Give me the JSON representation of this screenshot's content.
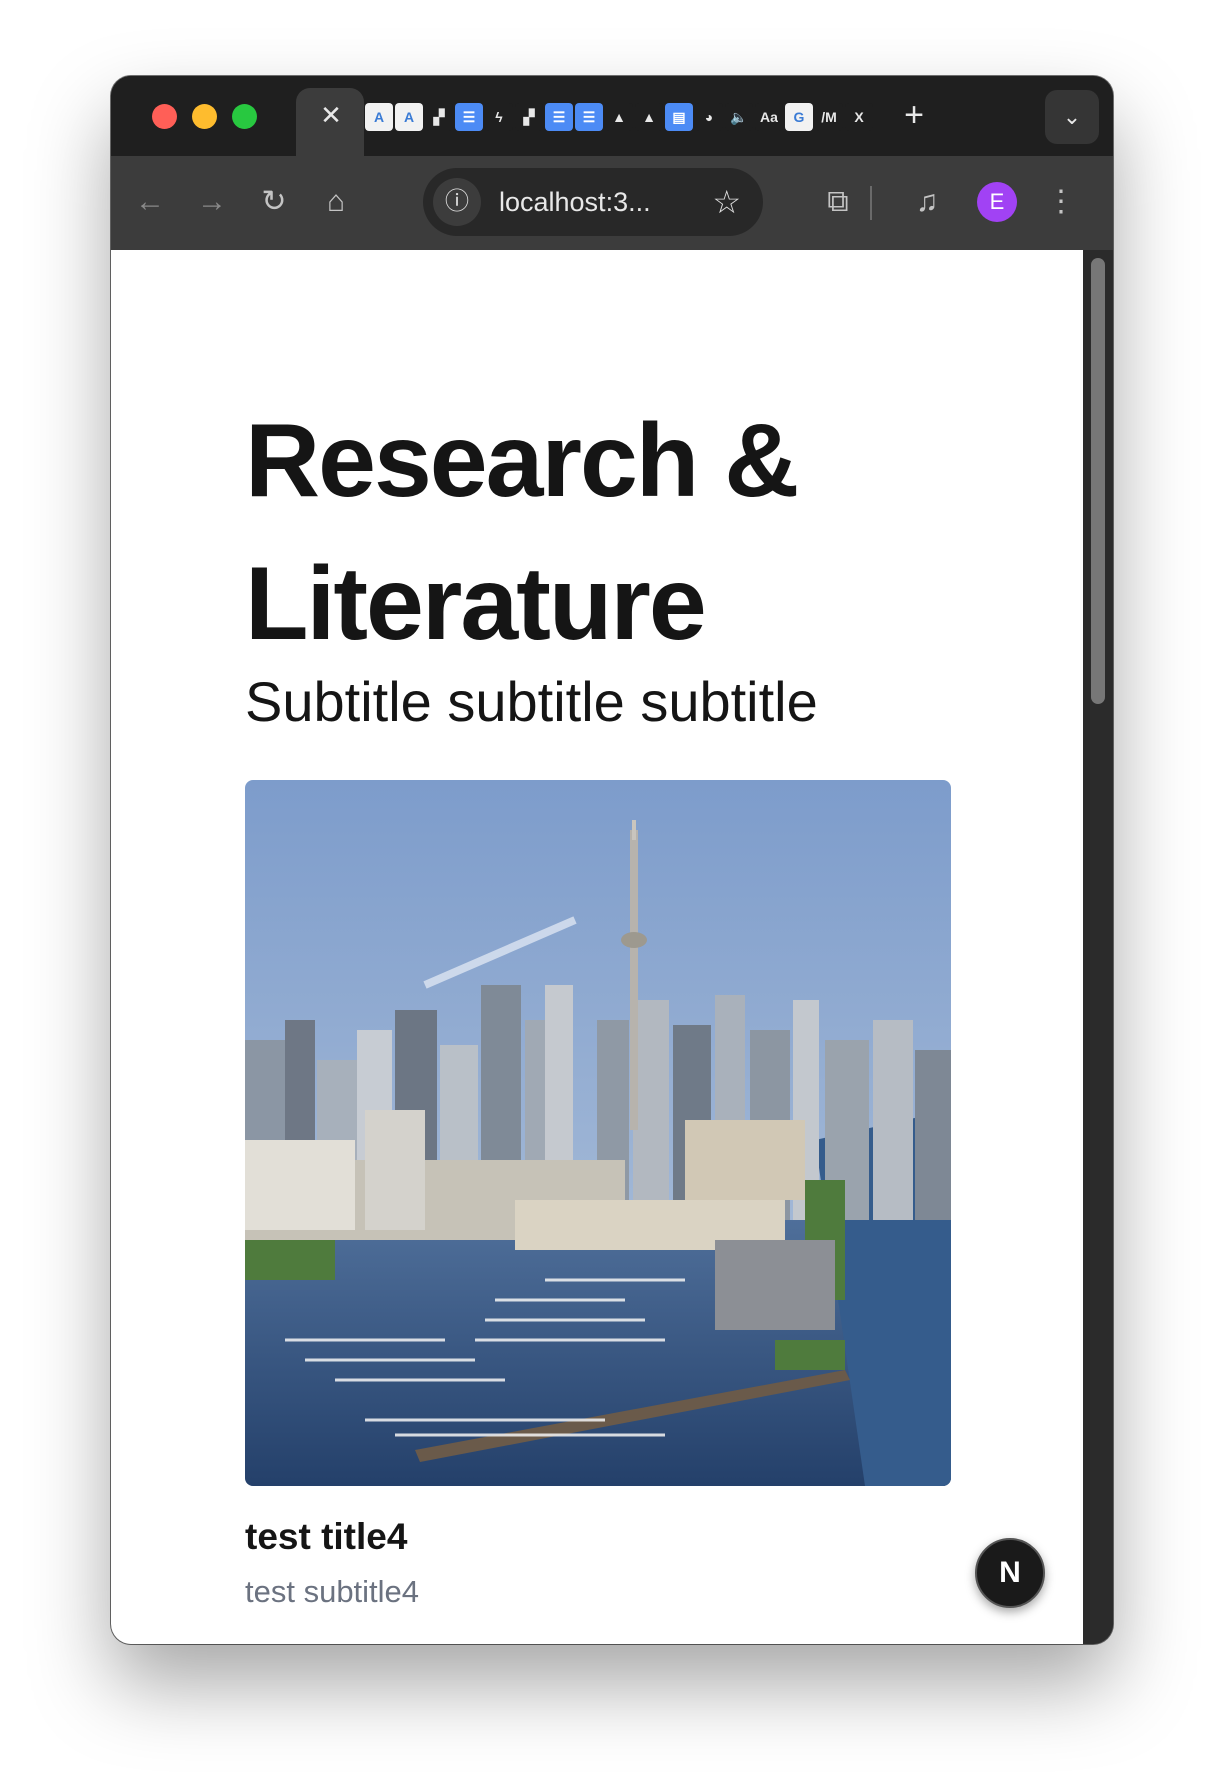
{
  "browser": {
    "tab_close_glyph": "✕",
    "favicons": [
      {
        "name": "arcis-favicon",
        "glyph": "A",
        "style": "white"
      },
      {
        "name": "arcis-favicon-2",
        "glyph": "A",
        "style": "white"
      },
      {
        "name": "linear-favicon",
        "glyph": "▞",
        "style": "dark"
      },
      {
        "name": "docs-favicon",
        "glyph": "☰",
        "style": "doc"
      },
      {
        "name": "bolt-favicon",
        "glyph": "ϟ",
        "style": "dark"
      },
      {
        "name": "linear-favicon-2",
        "glyph": "▞",
        "style": "dark"
      },
      {
        "name": "docs-favicon-2",
        "glyph": "☰",
        "style": "doc"
      },
      {
        "name": "docs-favicon-3",
        "glyph": "☰",
        "style": "doc"
      },
      {
        "name": "drive-favicon",
        "glyph": "▲",
        "style": "dark"
      },
      {
        "name": "drive-favicon-2",
        "glyph": "▲",
        "style": "dark"
      },
      {
        "name": "calendar-favicon",
        "glyph": "▤",
        "style": "doc"
      },
      {
        "name": "duck-favicon",
        "glyph": "◕",
        "style": "dark"
      },
      {
        "name": "audio-playing-icon",
        "glyph": "🔈",
        "style": "dark"
      },
      {
        "name": "font-favicon",
        "glyph": "Aa",
        "style": "dark"
      },
      {
        "name": "google-favicon",
        "glyph": "G",
        "style": "white"
      },
      {
        "name": "medium-favicon",
        "glyph": "/M",
        "style": "dark"
      },
      {
        "name": "excel-favicon",
        "glyph": "X",
        "style": "dark"
      }
    ],
    "new_tab_glyph": "+",
    "tab_menu_glyph": "⌄",
    "back_glyph": "←",
    "forward_glyph": "→",
    "reload_glyph": "↻",
    "home_glyph": "⌂",
    "info_glyph": "ⓘ",
    "url": "localhost:3...",
    "star_glyph": "☆",
    "extensions_glyph": "⧉",
    "media_glyph": "♫",
    "avatar_initial": "E",
    "menu_glyph": "⋮"
  },
  "page": {
    "title": "Research & Literature",
    "subtitle": "Subtitle subtitle subtitle",
    "card": {
      "title": "test title4",
      "subtitle": "test subtitle4"
    },
    "next_badge": "N"
  },
  "colors": {
    "avatar": "#a142f4",
    "card_subtitle": "#6b7280"
  }
}
